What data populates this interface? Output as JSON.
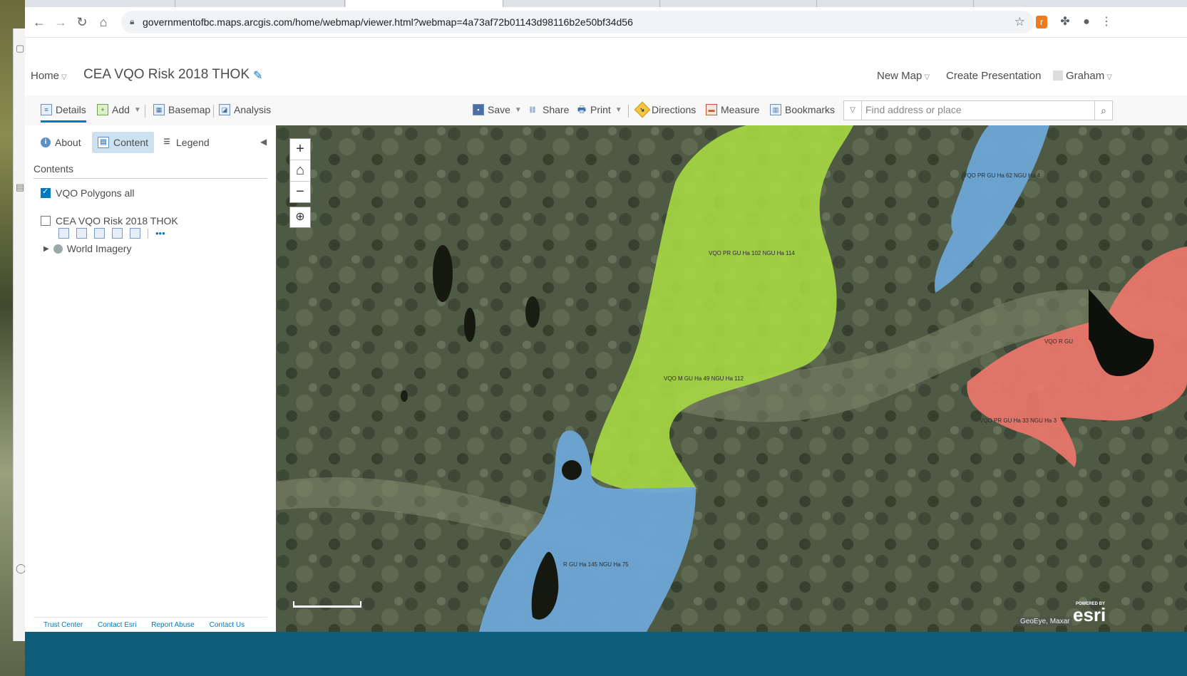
{
  "browser": {
    "url": "governmentofbc.maps.arcgis.com/home/webmap/viewer.html?webmap=4a73af72b01143d98116b2e50bf34d56"
  },
  "header": {
    "home_label": "Home",
    "map_title": "CEA VQO Risk 2018 THOK",
    "new_map_label": "New Map",
    "create_presentation_label": "Create Presentation",
    "user_label": "Graham"
  },
  "toolbar": {
    "details": "Details",
    "add": "Add",
    "basemap": "Basemap",
    "analysis": "Analysis",
    "save": "Save",
    "share": "Share",
    "print": "Print",
    "directions": "Directions",
    "measure": "Measure",
    "bookmarks": "Bookmarks",
    "search_placeholder": "Find address or place"
  },
  "panel": {
    "tabs": [
      "About",
      "Content",
      "Legend"
    ],
    "contents_title": "Contents",
    "layers": [
      {
        "name": "VQO Polygons all",
        "checked": true
      },
      {
        "name": "CEA VQO Risk 2018 THOK",
        "checked": false
      }
    ],
    "basemap_layer": "World Imagery",
    "footer_links": [
      "Trust Center",
      "Contact Esri",
      "Report Abuse",
      "Contact Us"
    ]
  },
  "map": {
    "polygon_labels": [
      "VQO PR GU Ha 102 NGU Ha 114",
      "VQO M GU Ha 49 NGU Ha 112",
      "VQO PR GU Ha 62 NGU Ha 4",
      "VQO R GU",
      "VQO PR GU Ha 33 NGU Ha 3",
      "R GU Ha 145 NGU Ha 75"
    ],
    "attribution": "GeoEye, Maxar",
    "esri_powered": "POWERED BY",
    "esri_logo": "esri",
    "colors": {
      "green": "#a6d843",
      "blue": "#6ea6d6",
      "red": "#e8766a"
    }
  }
}
